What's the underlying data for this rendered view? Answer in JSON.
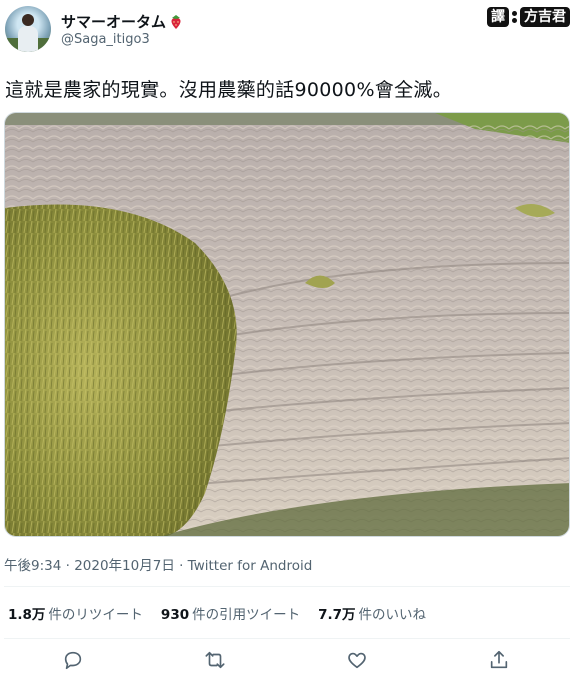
{
  "author": {
    "display_name": "サマーオータム",
    "handle": "@Saga_itigo3",
    "name_emoji": "strawberry-icon"
  },
  "translator": {
    "label": "譯",
    "name": "方吉君"
  },
  "tweet": {
    "text": "這就是農家的現實。沒用農藥的話90000%會全滅。",
    "timestamp": "午後9:34 · 2020年10月7日 · Twitter for Android"
  },
  "stats": [
    {
      "count": "1.8万",
      "label": "件のリツイート"
    },
    {
      "count": "930",
      "label": "件の引用ツイート"
    },
    {
      "count": "7.7万",
      "label": "件のいいね"
    }
  ],
  "actions": [
    "reply-icon",
    "retweet-icon",
    "like-icon",
    "share-icon"
  ],
  "colors": {
    "text": "#0f1419",
    "secondary": "#536471",
    "divider": "#eff3f4"
  }
}
